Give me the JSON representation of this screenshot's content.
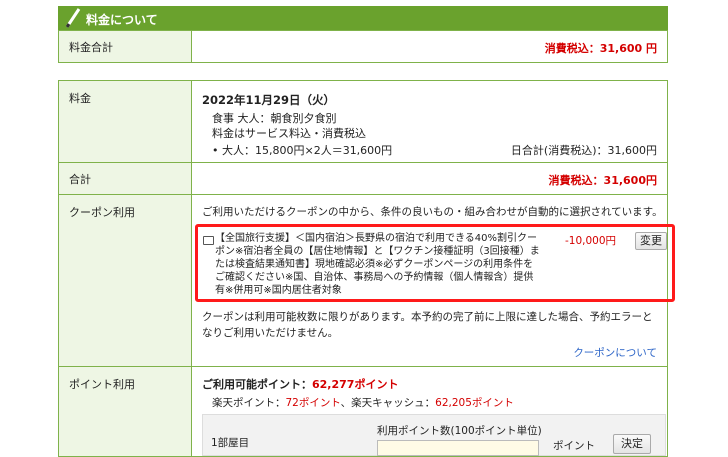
{
  "header": {
    "title": "料金について",
    "pen_icon": "pen-icon"
  },
  "total_box": {
    "label": "料金合計",
    "value": "消費税込：31,600 円"
  },
  "fee": {
    "label": "料金",
    "date": "2022年11月29日（火）",
    "meal": "食事 大人：朝食別夕食別",
    "tax_note": "料金はサービス料込・消費税込",
    "breakdown": "• 大人：15,800円×2人＝31,600円",
    "day_total": "日合計(消費税込)：31,600円"
  },
  "sum": {
    "label": "合計",
    "value": "消費税込：31,600円"
  },
  "coupon": {
    "label": "クーポン利用",
    "intro": "ご利用いただけるクーポンの中から、条件の良いもの・組み合わせが自動的に選択されています。",
    "item_lines": [
      "【全国旅行支援】＜国内宿泊＞長野県の宿泊で利用できる40%割引クー",
      "ポン※宿泊者全員の【居住地情報】と【ワクチン接種証明（3回接種）ま",
      "たは検査結果通知書】現地確認必須※必ずクーポンページの利用条件を",
      "ご確認ください※国、自治体、事務局への予約情報（個人情報含）提供",
      "有※併用可※国内居住者対象"
    ],
    "discount": "-10,000円",
    "change_button": "変更",
    "note_line1": "クーポンは利用可能枚数に限りがあります。本予約の完了前に上限に達した場合、予約エラーと",
    "note_line2": "なりご利用いただけません。",
    "about_link": "クーポンについて"
  },
  "points": {
    "label": "ポイント利用",
    "available_label": "ご利用可能ポイント：",
    "available_value": "62,277ポイント",
    "rakuten_label": "楽天ポイント：",
    "rakuten_value": "72ポイント",
    "cash_label": "、楽天キャッシュ：",
    "cash_value": "62,205ポイント",
    "room_label": "1部屋目",
    "input_label": "利用ポイント数(100ポイント単位)",
    "unit": "ポイント",
    "confirm_button": "決定"
  },
  "colors": {
    "accent_green": "#6aa22d",
    "label_bg": "#eef6e4",
    "red": "#d40000",
    "highlight": "#ff1a1a",
    "link": "#2a63c7"
  }
}
